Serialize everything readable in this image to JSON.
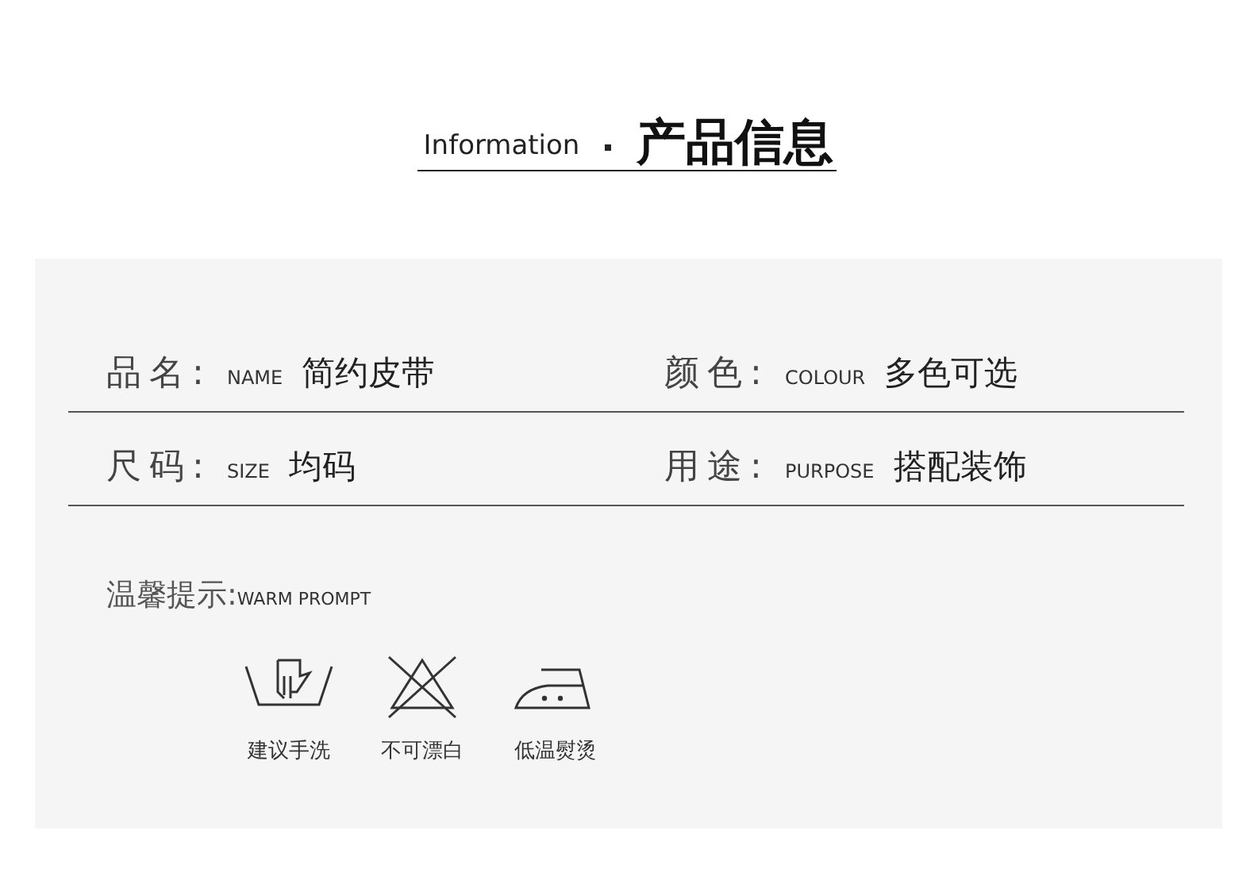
{
  "header": {
    "english": "Information",
    "chinese": "产品信息"
  },
  "specs": [
    [
      {
        "label": "品名:",
        "english": "NAME",
        "value": "简约皮带"
      },
      {
        "label": "颜色:",
        "english": "COLOUR",
        "value": "多色可选"
      }
    ],
    [
      {
        "label": "尺码:",
        "english": "SIZE",
        "value": "均码"
      },
      {
        "label": "用途:",
        "english": "PURPOSE",
        "value": "搭配装饰"
      }
    ]
  ],
  "warm_prompt": {
    "label": "温馨提示:",
    "english": "WARM PROMPT"
  },
  "care": [
    {
      "kind": "hand-wash",
      "label": "建议手洗"
    },
    {
      "kind": "no-bleach",
      "label": "不可漂白"
    },
    {
      "kind": "low-iron",
      "label": "低温熨烫"
    }
  ]
}
